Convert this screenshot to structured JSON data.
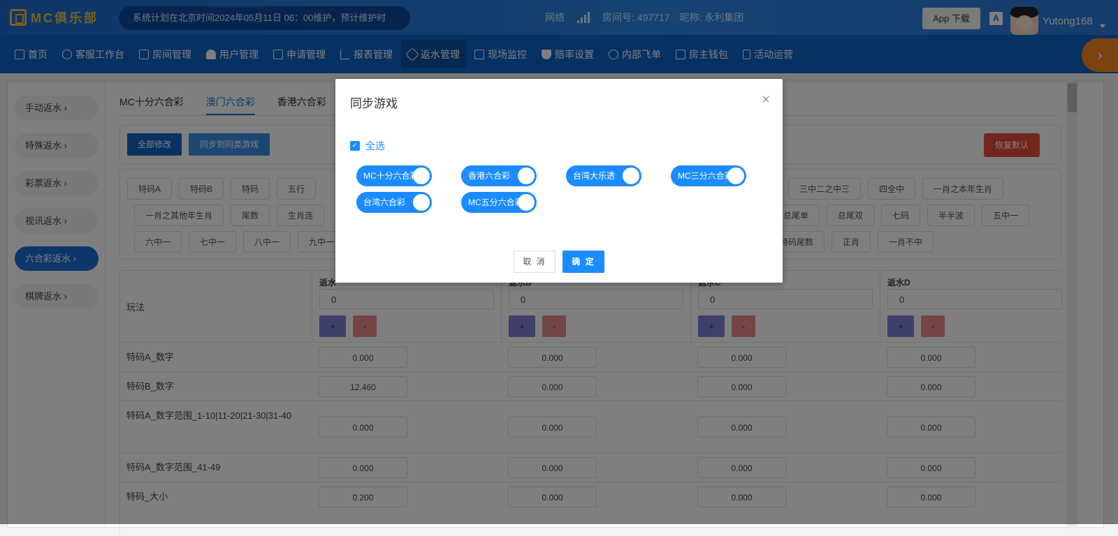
{
  "header": {
    "logo_text": "MC俱乐部",
    "notice": "系统计划在北京时间2024年05月11日 06：00维护，预计维护时",
    "network_label": "网络",
    "room_label": "房间号: 497717",
    "nickname_label": "昵称: 永利集团",
    "app_download": "App 下载",
    "translate_icon": "A",
    "username": "Yutong168"
  },
  "nav": {
    "items": [
      {
        "label": "首页",
        "icon": "home-icon"
      },
      {
        "label": "客服工作台",
        "icon": "headset-icon"
      },
      {
        "label": "房间管理",
        "icon": "grid-icon"
      },
      {
        "label": "用户管理",
        "icon": "user-icon"
      },
      {
        "label": "申请管理",
        "icon": "document-icon"
      },
      {
        "label": "报表管理",
        "icon": "bar-chart-icon"
      },
      {
        "label": "返水管理",
        "icon": "tag-icon",
        "active": true
      },
      {
        "label": "现场监控",
        "icon": "monitor-icon"
      },
      {
        "label": "赔率设置",
        "icon": "shield-icon"
      },
      {
        "label": "内部飞单",
        "icon": "refresh-icon"
      },
      {
        "label": "房主钱包",
        "icon": "wallet-icon"
      },
      {
        "label": "活动运营",
        "icon": "phone-icon"
      }
    ],
    "more": "›"
  },
  "sidebar": {
    "items": [
      {
        "label": "手动返水 ›"
      },
      {
        "label": "特殊返水 ›"
      },
      {
        "label": "彩票返水 ›"
      },
      {
        "label": "视讯返水 ›"
      },
      {
        "label": "六合彩返水 ›",
        "active": true
      },
      {
        "label": "棋牌返水 ›"
      }
    ]
  },
  "tabs": [
    "MC十分六合彩",
    "澳门六合彩",
    "香港六合彩"
  ],
  "actions": {
    "modify_all": "全部修改",
    "sync_similar": "同步到同类游戏",
    "restore_default": "恢复默认"
  },
  "play_types": {
    "row1_left": [
      "特码A",
      "特码B",
      "特码",
      "五行"
    ],
    "row1_right": [
      "三中二之中三",
      "四全中",
      "一肖之本年生肖"
    ],
    "row2_left": [
      "一肖之其他年生肖",
      "尾数",
      "生肖连"
    ],
    "row2_right": [
      "总尾单",
      "总尾双",
      "七码",
      "半半波",
      "五中一"
    ],
    "row3_left": [
      "六中一",
      "七中一",
      "八中一",
      "九中一"
    ],
    "row3_right": [
      "特码尾数",
      "正肖",
      "一肖不中"
    ]
  },
  "table": {
    "play_header": "玩法",
    "columns": [
      {
        "label": "返水",
        "value": "0"
      },
      {
        "label": "返水B",
        "value": "0"
      },
      {
        "label": "返水C",
        "value": "0"
      },
      {
        "label": "返水D",
        "value": "0"
      }
    ],
    "plus": "+",
    "minus": "-",
    "rows": [
      {
        "name": "特码A_数字",
        "values": [
          "0.000",
          "0.000",
          "0.000",
          "0.000"
        ]
      },
      {
        "name": "特码B_数字",
        "values": [
          "12.460",
          "0.000",
          "0.000",
          "0.000"
        ]
      },
      {
        "name": "特码A_数字范围_1-10|11-20|21-30|31-40",
        "values": [
          "0.000",
          "0.000",
          "0.000",
          "0.000"
        ]
      },
      {
        "name": "特码A_数字范围_41-49",
        "values": [
          "0.000",
          "0.000",
          "0.000",
          "0.000"
        ]
      },
      {
        "name": "特码_大小",
        "values": [
          "0.200",
          "0.000",
          "0.000",
          "0.000"
        ]
      }
    ]
  },
  "modal": {
    "title": "同步游戏",
    "select_all": "全选",
    "select_all_checked": true,
    "games": [
      {
        "label": "MC十分六合彩",
        "on": true
      },
      {
        "label": "香港六合彩",
        "on": true
      },
      {
        "label": "台湾大乐透",
        "on": true
      },
      {
        "label": "MC三分六合彩",
        "on": true
      },
      {
        "label": "台湾六合彩",
        "on": true
      },
      {
        "label": "MC五分六合彩",
        "on": true
      }
    ],
    "cancel": "取 消",
    "confirm": "确 定"
  },
  "colors": {
    "primary": "#1a8cff",
    "nav_bg": "#0d63c6",
    "danger": "#e74c3c",
    "accent_orange": "#f6861f"
  }
}
